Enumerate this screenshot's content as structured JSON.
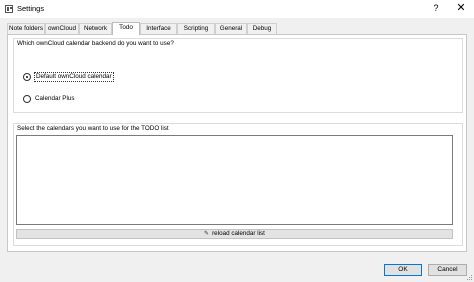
{
  "window": {
    "title": "Settings",
    "help": "?",
    "close": "✕"
  },
  "tabs": [
    {
      "label": "Note folders",
      "active": false
    },
    {
      "label": "ownCloud",
      "active": false
    },
    {
      "label": "Network",
      "active": false
    },
    {
      "label": "Todo",
      "active": true
    },
    {
      "label": "Interface",
      "active": false
    },
    {
      "label": "Scripting",
      "active": false
    },
    {
      "label": "General",
      "active": false
    },
    {
      "label": "Debug",
      "active": false
    }
  ],
  "backend_group": {
    "title": "Which ownCloud calendar backend do you want to use?",
    "options": [
      {
        "label": "Default ownCloud calendar",
        "checked": true
      },
      {
        "label": "Calendar Plus",
        "checked": false
      }
    ]
  },
  "calendars_group": {
    "title": "Select the calendars you want to use for the TODO list",
    "reload_label": "reload calendar list",
    "reload_icon": "pencil-icon"
  },
  "dialog_buttons": {
    "ok": "OK",
    "cancel": "Cancel"
  }
}
